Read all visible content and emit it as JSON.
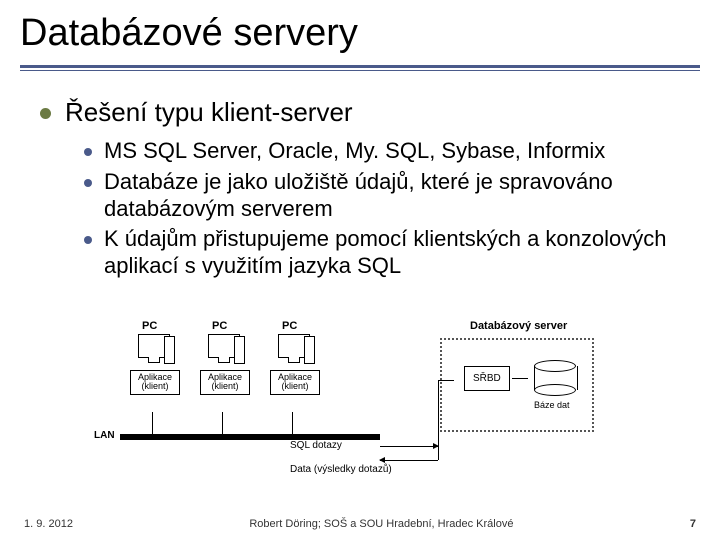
{
  "title": "Databázové servery",
  "lvl1": "Řešení typu klient-server",
  "lvl2": [
    "MS SQL Server, Oracle, My. SQL, Sybase, Informix",
    "Databáze je jako uložiště údajů, které je spravováno databázovým serverem",
    "K údajům přistupujeme pomocí klientských a konzolových aplikací s využitím jazyka SQL"
  ],
  "diagram": {
    "pc_label": "PC",
    "app1": "Aplikace (klient)",
    "app2": "Aplikace (klient)",
    "app3": "Aplikace (klient)",
    "server_title": "Databázový server",
    "srbd": "SŘBD",
    "db_caption": "Báze dat",
    "lan": "LAN",
    "q": "SQL dotazy",
    "r": "Data (výsledky dotazů)"
  },
  "footer": {
    "date": "1. 9. 2012",
    "author": "Robert Döring; SOŠ a SOU Hradební, Hradec Králové",
    "page": "7"
  }
}
